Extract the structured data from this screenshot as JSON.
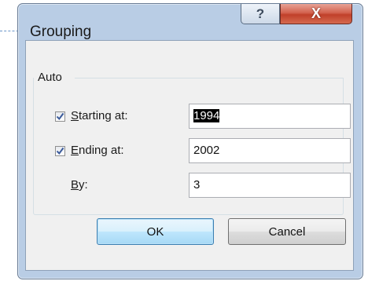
{
  "window": {
    "title": "Grouping",
    "help_glyph": "?",
    "close_glyph": "X"
  },
  "group": {
    "label": "Auto"
  },
  "fields": {
    "starting": {
      "label_mnemonic": "S",
      "label_rest": "tarting at:",
      "checked": true,
      "value": "1994",
      "selected": true
    },
    "ending": {
      "label_mnemonic": "E",
      "label_rest": "nding at:",
      "checked": true,
      "value": "2002"
    },
    "by": {
      "label_mnemonic": "B",
      "label_rest": "y:",
      "value": "3"
    }
  },
  "buttons": {
    "ok": "OK",
    "cancel": "Cancel"
  },
  "colors": {
    "frame": "#b9cde5",
    "close_red": "#c0402a",
    "selection": "#000000"
  },
  "icons": {
    "help": "help-icon",
    "close": "close-icon",
    "check": "checkmark-icon"
  }
}
